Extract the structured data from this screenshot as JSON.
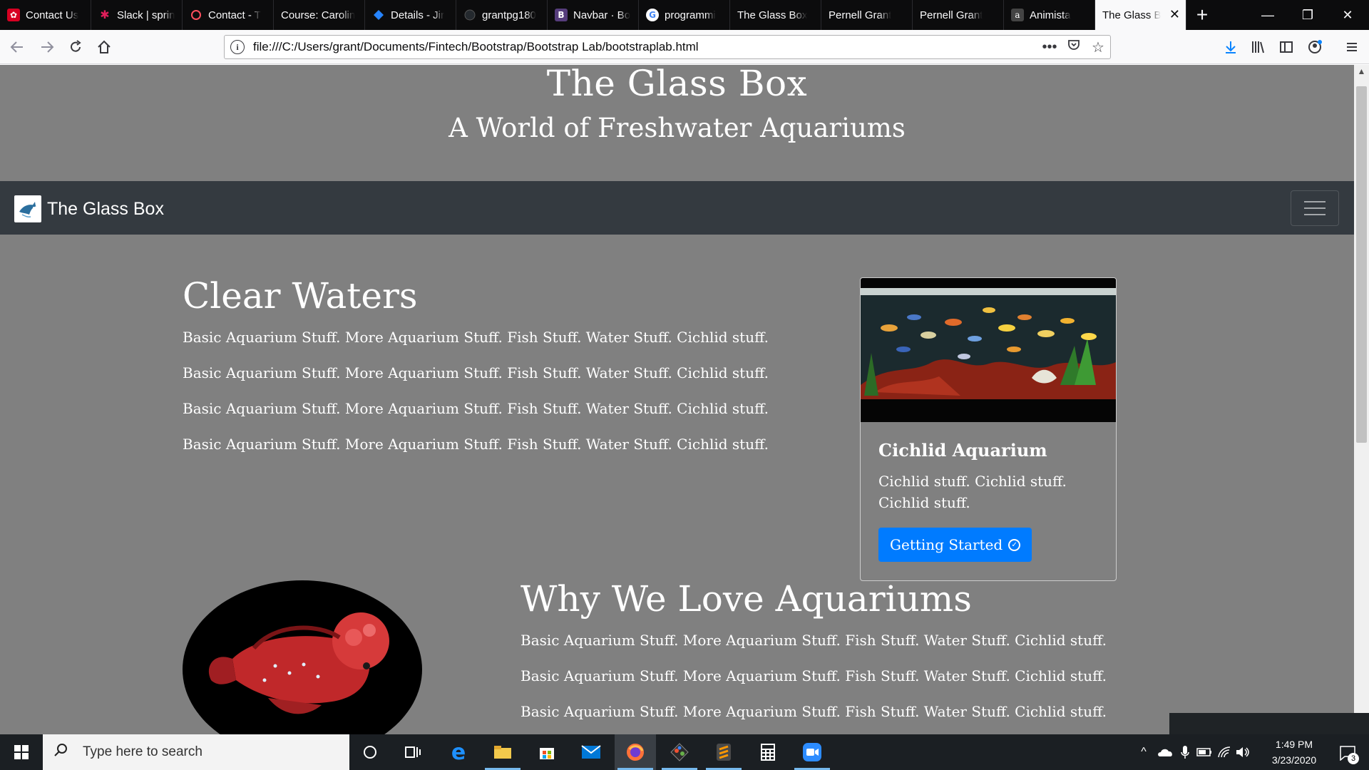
{
  "browser": {
    "tabs": [
      {
        "title": "Contact Us",
        "favicon": "red-seal-icon",
        "color": "#d70022"
      },
      {
        "title": "Slack | sprin",
        "favicon": "slack-icon",
        "color": "#e01e5a"
      },
      {
        "title": "Contact - T",
        "favicon": "ring-icon",
        "color": "#ff4f5e"
      },
      {
        "title": "Course: Carolin",
        "favicon": "",
        "color": ""
      },
      {
        "title": "Details - Jir",
        "favicon": "jira-icon",
        "color": "#2684ff"
      },
      {
        "title": "grantpg180",
        "favicon": "github-icon",
        "color": "#24292e"
      },
      {
        "title": "Navbar · Bo",
        "favicon": "bootstrap-icon",
        "color": "#563d7c"
      },
      {
        "title": "programmi",
        "favicon": "google-icon",
        "color": "#4285f4"
      },
      {
        "title": "The Glass Box",
        "favicon": "",
        "color": ""
      },
      {
        "title": "Pernell Grant",
        "favicon": "",
        "color": ""
      },
      {
        "title": "Pernell Grant",
        "favicon": "",
        "color": ""
      },
      {
        "title": "Animista",
        "favicon": "animista-icon",
        "color": "#444"
      },
      {
        "title": "The Glass Bo",
        "favicon": "",
        "color": "",
        "active": true
      }
    ],
    "url": "file:///C:/Users/grant/Documents/Fintech/Bootstrap/Bootstrap Lab/bootstraplab.html"
  },
  "page": {
    "jumbotron": {
      "title": "The Glass Box",
      "subtitle": "A World of Freshwater Aquariums"
    },
    "navbar": {
      "brand": "The Glass Box"
    },
    "section1": {
      "title": "Clear Waters",
      "paragraphs": [
        "Basic Aquarium Stuff. More Aquarium Stuff. Fish Stuff. Water Stuff. Cichlid stuff.",
        "Basic Aquarium Stuff. More Aquarium Stuff. Fish Stuff. Water Stuff. Cichlid stuff.",
        "Basic Aquarium Stuff. More Aquarium Stuff. Fish Stuff. Water Stuff. Cichlid stuff.",
        "Basic Aquarium Stuff. More Aquarium Stuff. Fish Stuff. Water Stuff. Cichlid stuff."
      ]
    },
    "card": {
      "title": "Cichlid Aquarium",
      "text": "Cichlid stuff. Cichlid stuff. Cichlid stuff.",
      "button": "Getting Started"
    },
    "section2": {
      "title": "Why We Love Aquariums",
      "paragraphs": [
        "Basic Aquarium Stuff. More Aquarium Stuff. Fish Stuff. Water Stuff. Cichlid stuff.",
        "Basic Aquarium Stuff. More Aquarium Stuff. Fish Stuff. Water Stuff. Cichlid stuff.",
        "Basic Aquarium Stuff. More Aquarium Stuff. Fish Stuff. Water Stuff. Cichlid stuff."
      ]
    }
  },
  "taskbar": {
    "search_placeholder": "Type here to search",
    "time": "1:49 PM",
    "date": "3/23/2020",
    "notification_count": "3"
  },
  "colors": {
    "page_bg": "#808080",
    "navbar_bg": "#343a40",
    "button_primary": "#007bff"
  }
}
